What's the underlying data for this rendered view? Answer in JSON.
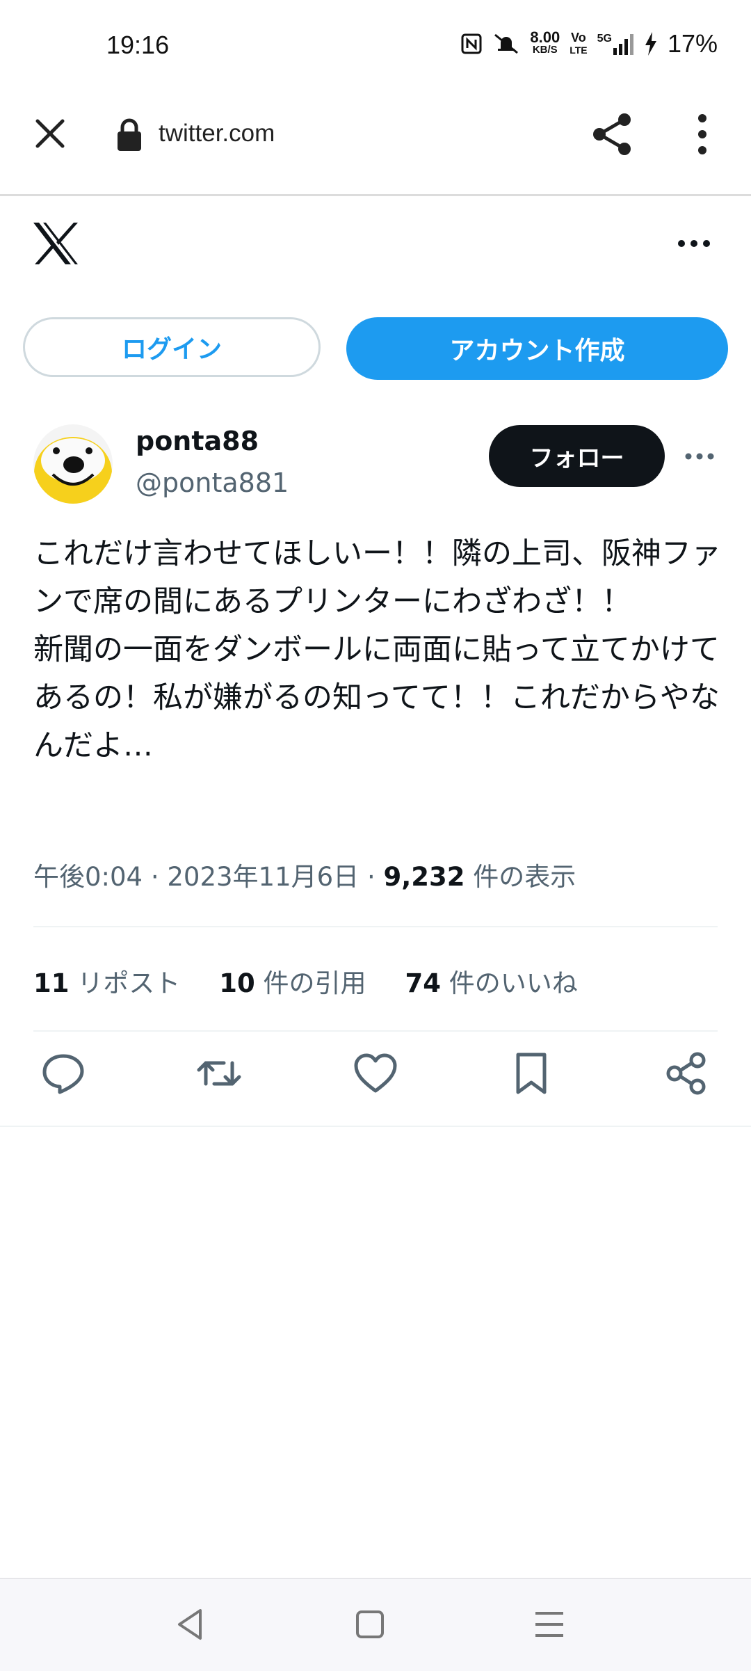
{
  "status_bar": {
    "time": "19:16",
    "net_speed_value": "8.00",
    "net_speed_unit": "KB/S",
    "volte_top": "Vo",
    "volte_bottom": "LTE",
    "signal_label": "5G",
    "battery": "17%"
  },
  "browser": {
    "url": "twitter.com"
  },
  "header": {
    "login_label": "ログイン",
    "signup_label": "アカウント作成"
  },
  "tweet": {
    "display_name": "ponta88",
    "handle": "@ponta881",
    "follow_label": "フォロー",
    "text": "これだけ言わせてほしいー！！隣の上司、阪神ファンで席の間にあるプリンターにわざわざ！！\n新聞の一面をダンボールに両面に貼って立てかけてあるの！私が嫌がるの知ってて！！これだからやなんだよ…",
    "time": "午後0:04",
    "date": "2023年11月6日",
    "views_count": "9,232",
    "views_label": "件の表示",
    "reposts_count": "11",
    "reposts_label": "リポスト",
    "quotes_count": "10",
    "quotes_label": "件の引用",
    "likes_count": "74",
    "likes_label": "件のいいね"
  },
  "colors": {
    "accent": "#1d9bf0",
    "text": "#0f1419",
    "secondary": "#536471"
  }
}
